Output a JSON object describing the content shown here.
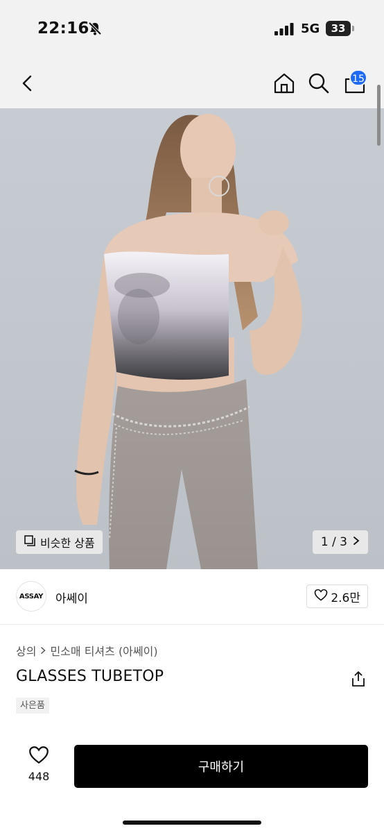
{
  "status_bar": {
    "time": "22:16",
    "network": "5G",
    "battery": "33"
  },
  "nav": {
    "cart_count": "15"
  },
  "gallery": {
    "similar_label": "비슷한 상품",
    "page_indicator": "1 / 3"
  },
  "brand": {
    "logo_text": "ASSAY",
    "name": "아쎄이",
    "like_count": "2.6만"
  },
  "product": {
    "breadcrumb": [
      "상의",
      "민소매 티셔츠 (아쎄이)"
    ],
    "title": "GLASSES TUBETOP",
    "tag": "사은품"
  },
  "bottom": {
    "like_count": "448",
    "buy_label": "구매하기"
  },
  "colors": {
    "accent": "#1f6af5",
    "buy_button": "#000000"
  },
  "icons": [
    "bell-slash-icon",
    "signal-icon",
    "back-icon",
    "home-icon",
    "search-icon",
    "cart-icon",
    "similar-icon",
    "chevron-right-icon",
    "heart-icon",
    "share-icon"
  ]
}
